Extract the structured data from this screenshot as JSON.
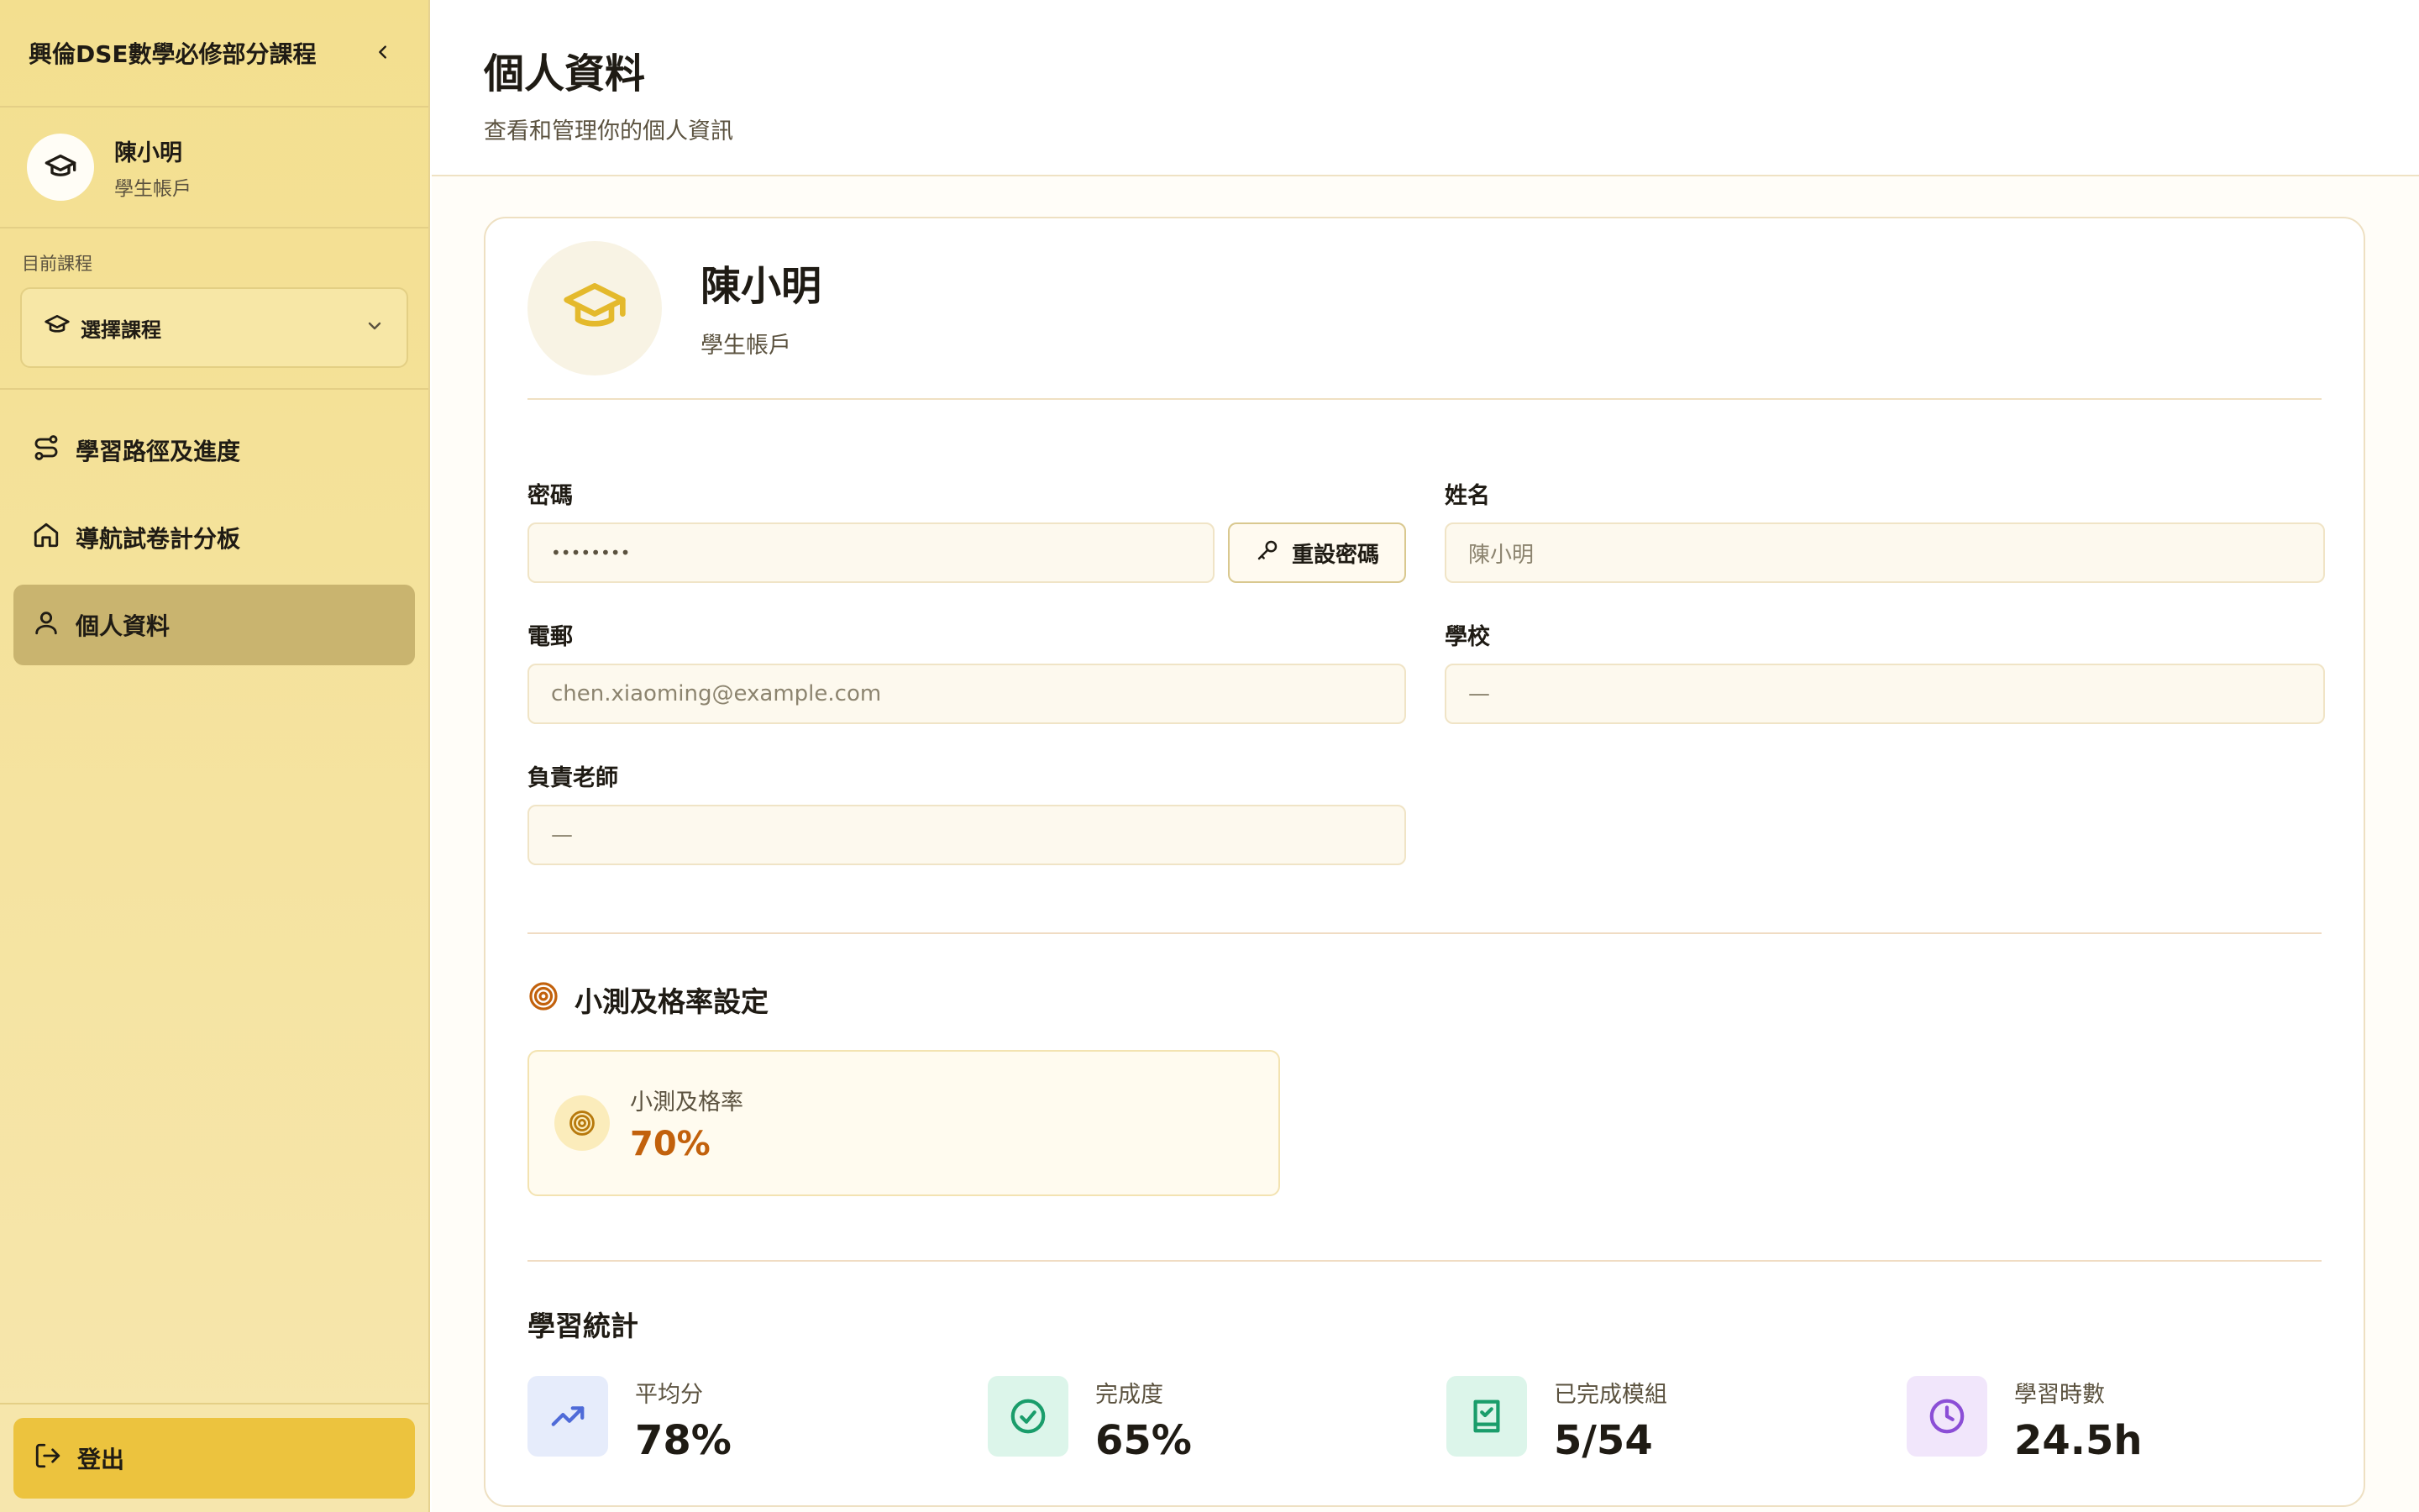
{
  "sidebar": {
    "title": "興倫DSE數學必修部分課程",
    "user": {
      "name": "陳小明",
      "role": "學生帳戶"
    },
    "course": {
      "label": "目前課程",
      "select_placeholder": "選擇課程"
    },
    "nav": [
      {
        "label": "學習路徑及進度",
        "icon": "route-icon"
      },
      {
        "label": "導航試卷計分板",
        "icon": "home-icon"
      },
      {
        "label": "個人資料",
        "icon": "user-icon",
        "active": true
      }
    ],
    "logout_label": "登出"
  },
  "page": {
    "title": "個人資料",
    "subtitle": "查看和管理你的個人資訊"
  },
  "profile": {
    "name": "陳小明",
    "role": "學生帳戶",
    "password": {
      "label": "密碼",
      "value": "••••••••",
      "reset_label": "重設密碼"
    },
    "name_field": {
      "label": "姓名",
      "value": "陳小明"
    },
    "email": {
      "label": "電郵",
      "value": "chen.xiaoming@example.com"
    },
    "school": {
      "label": "學校",
      "value": "—"
    },
    "teacher": {
      "label": "負責老師",
      "value": "—"
    }
  },
  "quiz": {
    "section_title": "小測及格率設定",
    "pass_label": "小測及格率",
    "pass_value": "70%"
  },
  "stats": {
    "section_title": "學習統計",
    "items": [
      {
        "label": "平均分",
        "value": "78%",
        "icon": "trending-up-icon",
        "color": "#4f6bd8",
        "bg": "#e6ecfb"
      },
      {
        "label": "完成度",
        "value": "65%",
        "icon": "check-circle-icon",
        "color": "#1a9d6b",
        "bg": "#dcf5ea"
      },
      {
        "label": "已完成模組",
        "value": "5/54",
        "icon": "book-check-icon",
        "color": "#1a9d6b",
        "bg": "#dcf5ea"
      },
      {
        "label": "學習時數",
        "value": "24.5h",
        "icon": "clock-icon",
        "color": "#8b4ed6",
        "bg": "#f1e6fb"
      }
    ]
  },
  "colors": {
    "accent": "#ecc33e",
    "sidebar_bg": "#f3df8f",
    "quiz_value": "#c2610c"
  }
}
